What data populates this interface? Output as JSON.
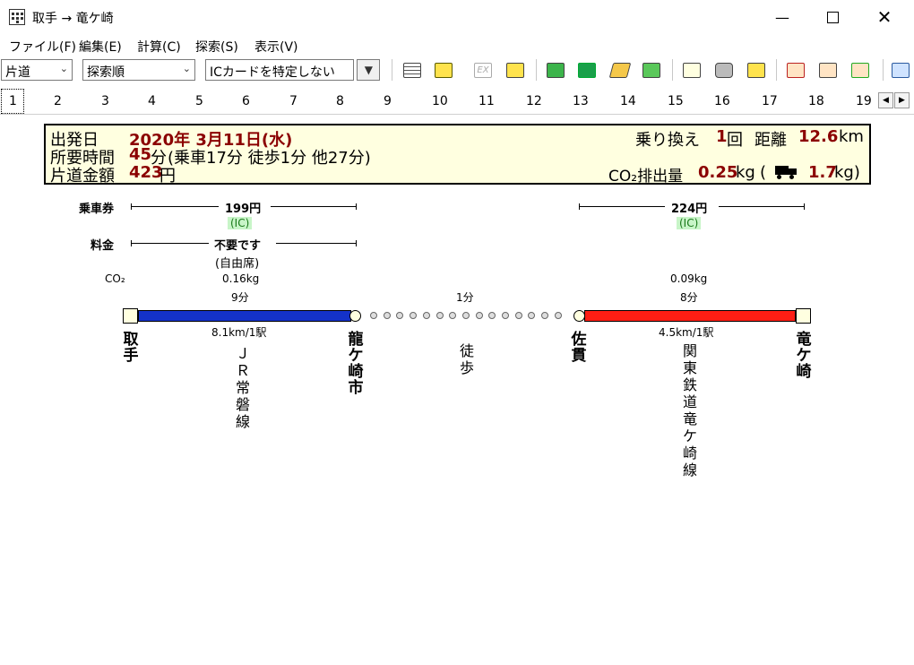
{
  "window": {
    "title": "取手 → 竜ケ崎"
  },
  "menu": [
    "ファイル(F)",
    "編集(E)",
    "計算(C)",
    "探索(S)",
    "表示(V)"
  ],
  "toolbar": {
    "trip_type": "片道",
    "sort_order": "探索順",
    "ic_card": "ICカードを特定しない",
    "ex_label": "EX"
  },
  "tabs": [
    "1",
    "2",
    "3",
    "4",
    "5",
    "6",
    "7",
    "8",
    "9",
    "10",
    "11",
    "12",
    "13",
    "14",
    "15",
    "16",
    "17",
    "18",
    "19"
  ],
  "summary": {
    "depart_label": "出発日",
    "depart_value": "2020年 3月11日(水)",
    "time_label": "所要時間",
    "time_value": "45",
    "time_unit": "分",
    "time_detail": "(乗車17分 徒歩1分 他27分)",
    "fare_label": "片道金額",
    "fare_value": "423",
    "fare_unit": "円",
    "transfer_label": "乗り換え",
    "transfer_value": "1",
    "transfer_unit": "回",
    "distance_label": "距離",
    "distance_value": "12.6",
    "distance_unit": "km",
    "co2_label": "CO₂排出量",
    "co2_value": "0.25",
    "co2_unit": "kg",
    "car_open": "(",
    "car_value": "1.7",
    "car_unit": "kg)"
  },
  "route": {
    "ticket_label": "乗車券",
    "fee_label": "料金",
    "co2_label": "CO₂",
    "segments": [
      {
        "fare": "199円",
        "ic": "(IC)",
        "fee": "不要です",
        "fee_note": "(自由席)",
        "co2": "0.16kg",
        "time": "9分",
        "distance": "8.1km/1駅",
        "line": "ＪＲ常磐線",
        "color": "#1432c8"
      },
      {
        "time": "1分",
        "line": "徒歩"
      },
      {
        "fare": "224円",
        "ic": "(IC)",
        "co2": "0.09kg",
        "time": "8分",
        "distance": "4.5km/1駅",
        "line": "関東鉄道竜ケ崎線",
        "color": "#ff1e14"
      }
    ],
    "stations": [
      "取手",
      "龍ケ崎市",
      "佐貫",
      "竜ケ崎"
    ]
  }
}
